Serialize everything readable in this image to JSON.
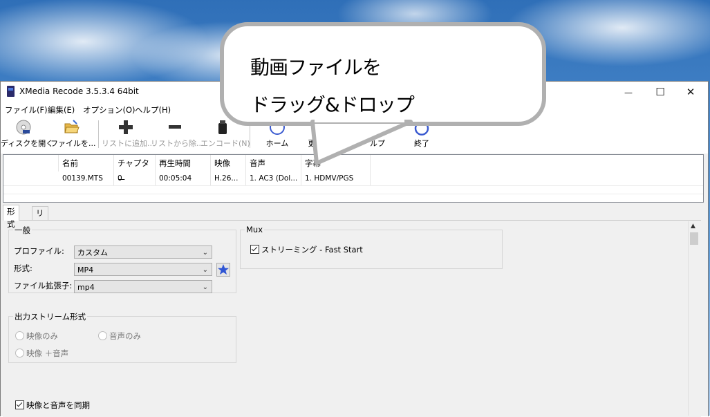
{
  "window": {
    "title": "XMedia Recode 3.5.3.4 64bit"
  },
  "window_controls": {
    "minimize": "—",
    "maximize": "☐",
    "close": "✕"
  },
  "menu": [
    "ファイル(F)",
    "編集(E)",
    "オプション(O)",
    "ヘルプ(H)"
  ],
  "toolbar": {
    "open_disc": "ディスクを開く",
    "open_file": "ファイルを...",
    "add_list": "リストに追加...",
    "remove_list": "リストから除...",
    "encode": "エンコード(N)",
    "home": "ホーム",
    "update": "更",
    "help": "ルプ",
    "exit": "終了"
  },
  "file_table": {
    "columns": [
      "名前",
      "チャプター",
      "再生時間",
      "映像",
      "音声",
      "字幕"
    ],
    "rows": [
      [
        "00139.MTS",
        "0",
        "00:05:04",
        "H.26...",
        "1. AC3 (Dol...",
        "1. HDMV/PGS"
      ]
    ]
  },
  "tabs": [
    "形式",
    "リスト"
  ],
  "general": {
    "title": "一般",
    "profile_label": "プロファイル:",
    "profile_value": "カスタム",
    "format_label": "形式:",
    "format_value": "MP4",
    "ext_label": "ファイル拡張子:",
    "ext_value": "mp4"
  },
  "mux": {
    "title": "Mux",
    "streaming_label": "ストリーミング - Fast Start",
    "streaming_checked": true
  },
  "output_stream": {
    "title": "出力ストリーム形式",
    "video_only": "映像のみ",
    "audio_only": "音声のみ",
    "video_audio": "映像 ＋音声"
  },
  "sync": {
    "label": "映像と音声を同期",
    "checked": true
  },
  "callout": {
    "line1": "動画ファイルを",
    "line2": "ドラッグ&ドロップ"
  },
  "colors": {
    "favorite_star": "#2f55d4",
    "callout_border": "#b0b0b0"
  }
}
